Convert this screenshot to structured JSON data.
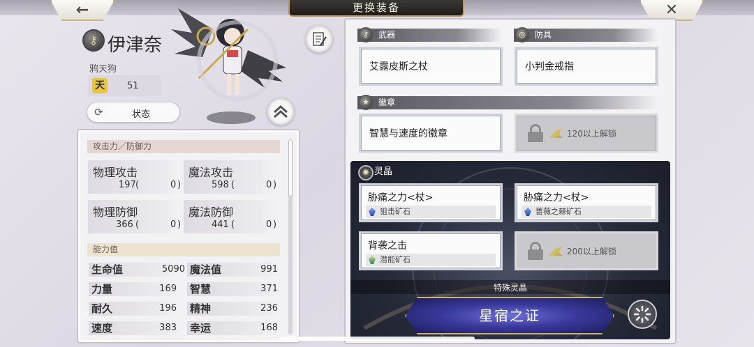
{
  "header": {
    "title": "更换装备",
    "back_icon": "←",
    "close_icon": "✕"
  },
  "character": {
    "name": "伊津奈",
    "name_icon": "key-icon",
    "subtitle": "鸦天狗",
    "rank_badge": "天",
    "level": "51",
    "status_label": "状态",
    "status_icon": "⟳"
  },
  "stats": {
    "attack_defense_header": "攻击力／防御力",
    "cards": [
      {
        "label": "物理攻击",
        "value": "197",
        "bonus": "0"
      },
      {
        "label": "魔法攻击",
        "value": "598",
        "bonus": "0"
      },
      {
        "label": "物理防御",
        "value": "366",
        "bonus": "0"
      },
      {
        "label": "魔法防御",
        "value": "441",
        "bonus": "0"
      }
    ],
    "ability_header": "能力值",
    "abilities": [
      {
        "label": "生命值",
        "value": "5090"
      },
      {
        "label": "魔法值",
        "value": "991"
      },
      {
        "label": "力量",
        "value": "169"
      },
      {
        "label": "智慧",
        "value": "371"
      },
      {
        "label": "耐久",
        "value": "196"
      },
      {
        "label": "精神",
        "value": "236"
      },
      {
        "label": "速度",
        "value": "383"
      },
      {
        "label": "幸运",
        "value": "168"
      }
    ]
  },
  "equipment": {
    "weapon_label": "武器",
    "weapon_item": "艾露皮斯之杖",
    "armor_label": "防具",
    "armor_item": "小判金戒指",
    "emblem_label": "徽章",
    "emblem_item": "智慧与速度的徽章",
    "emblem_locked_text": "120以上解锁"
  },
  "crystals": {
    "label": "灵晶",
    "slots": [
      {
        "name": "胁痛之力<杖>",
        "ore": "狙击矿石"
      },
      {
        "name": "胁痛之力<杖>",
        "ore": "蔷薇之棘矿石"
      },
      {
        "name": "背袭之击",
        "ore": "潜能矿石"
      }
    ],
    "locked_text": "200以上解锁",
    "special_label": "特殊灵晶",
    "special_button": "星宿之证"
  }
}
